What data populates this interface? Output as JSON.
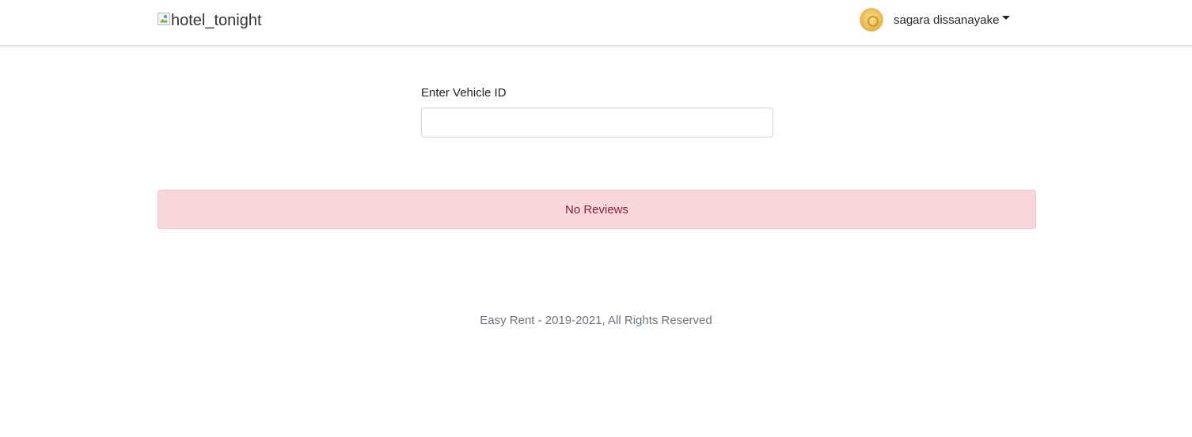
{
  "navbar": {
    "brand_alt": "hotel_tonight",
    "user_name": "sagara dissanayake"
  },
  "form": {
    "label": "Enter Vehicle ID",
    "value": "",
    "placeholder": ""
  },
  "alert": {
    "message": "No Reviews"
  },
  "footer": {
    "text": "Easy Rent - 2019-2021, All Rights Reserved"
  },
  "colors": {
    "alert_bg": "#f8d7da",
    "alert_text": "#842029",
    "footer_text": "#6c757d"
  }
}
